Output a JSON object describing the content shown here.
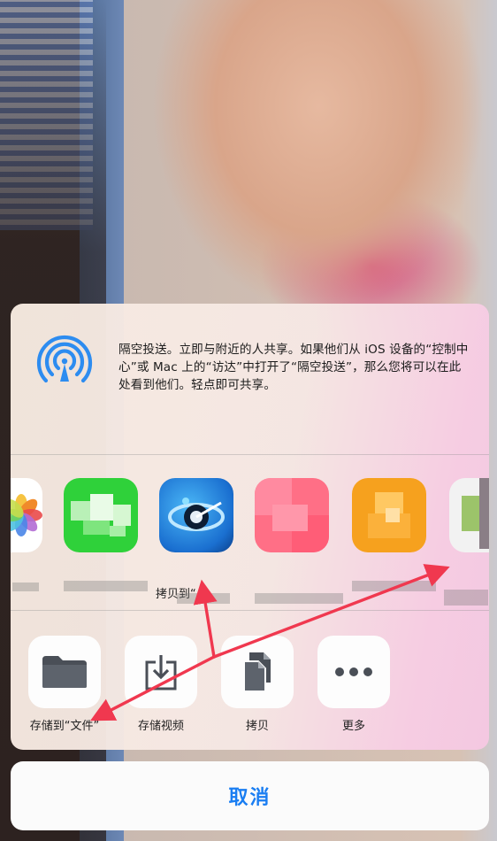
{
  "airdrop": {
    "text": "隔空投送。立即与附近的人共享。如果他们从 iOS 设备的“控制中心”或 Mac 上的“访达”中打开了“隔空投送”，那么您将可以在此处看到他们。轻点即可共享。"
  },
  "apps": [
    {
      "name": "photos",
      "label": "享"
    },
    {
      "name": "wechat",
      "label": ""
    },
    {
      "name": "qq-player",
      "label": "拷贝到“"
    },
    {
      "name": "pink-app",
      "label": ""
    },
    {
      "name": "orange-app",
      "label": ""
    },
    {
      "name": "edge-app",
      "label": ""
    }
  ],
  "actions": [
    {
      "label": "存储到“文件”",
      "icon": "folder-icon"
    },
    {
      "label": "存储视频",
      "icon": "save-video-icon"
    },
    {
      "label": "拷贝",
      "icon": "copy-icon"
    },
    {
      "label": "更多",
      "icon": "more-icon"
    }
  ],
  "cancel_label": "取消",
  "colors": {
    "accent": "#1a7ef2",
    "airdrop": "#2d8cf0",
    "arrow": "#f0384f"
  }
}
